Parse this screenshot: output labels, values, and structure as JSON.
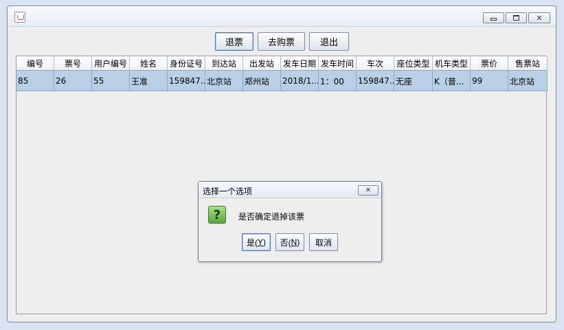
{
  "window": {
    "title": ""
  },
  "toolbar": {
    "refund_label": "退票",
    "buy_label": "去购票",
    "exit_label": "退出"
  },
  "table": {
    "columns": [
      "编号",
      "票号",
      "用户编号",
      "姓名",
      "身份证号",
      "到达站",
      "出发站",
      "发车日期",
      "发车时间",
      "车次",
      "座位类型",
      "机车类型",
      "票价",
      "售票站"
    ],
    "rows": [
      [
        "85",
        "26",
        "55",
        "王准",
        "159847...",
        "北京站",
        "郑州站",
        "2018/1...",
        "1：00",
        "159847...",
        "无座",
        "K（普...",
        "99",
        "北京站"
      ]
    ],
    "selected_row": 0
  },
  "dialog": {
    "title": "选择一个选项",
    "message": "是否确定退掉该票",
    "icon": "question-icon",
    "yes_label": "是(",
    "yes_mnemonic": "Y",
    "yes_suffix": ")",
    "no_label": "否(",
    "no_mnemonic": "N",
    "no_suffix": ")",
    "cancel_label": "取消"
  },
  "colors": {
    "selection": "#b8cfe5",
    "window_bg": "#eeeeee",
    "icon_green": "#58a640"
  }
}
